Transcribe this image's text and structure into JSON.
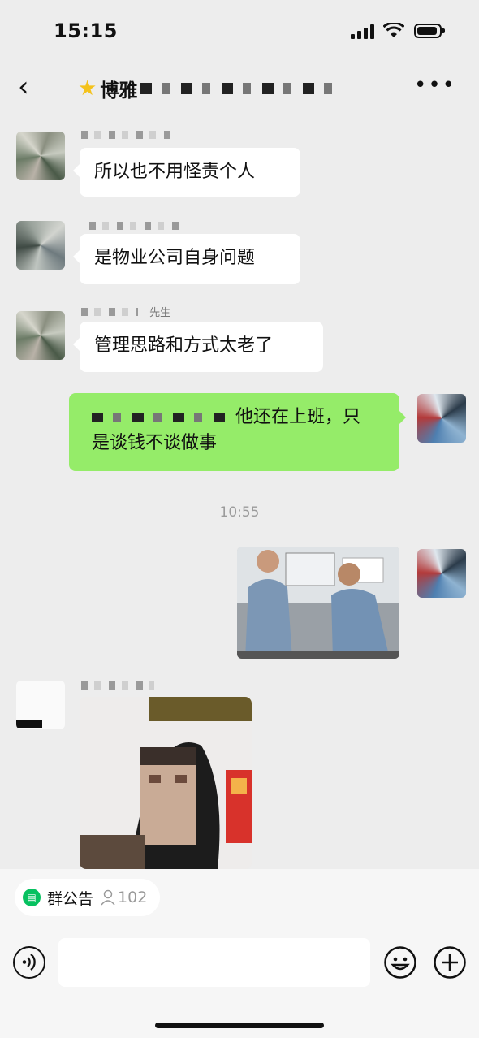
{
  "status_bar": {
    "time": "15:15"
  },
  "header": {
    "title_prefix": "博雅",
    "back_icon": "chevron-left-icon",
    "more_icon": "ellipsis-icon",
    "star_icon": "star-icon"
  },
  "messages": [
    {
      "type": "text",
      "side": "left",
      "text": "所以也不用怪责个人"
    },
    {
      "type": "text",
      "side": "left",
      "text": "是物业公司自身问题"
    },
    {
      "type": "text",
      "side": "left",
      "sender_suffix": "先生",
      "text": "管理思路和方式太老了"
    },
    {
      "type": "text",
      "side": "right",
      "line1": "他还在上班，只",
      "line2": "是谈钱不谈做事"
    },
    {
      "type": "timestamp",
      "text": "10:55"
    },
    {
      "type": "image",
      "side": "right",
      "icon": "photo-icon"
    },
    {
      "type": "image",
      "side": "left",
      "icon": "photo-icon"
    }
  ],
  "notice_bar": {
    "label": "群公告",
    "member_count": "102"
  },
  "input_bar": {
    "voice_icon": "voice-icon",
    "emoji_icon": "emoji-icon",
    "plus_icon": "plus-icon",
    "placeholder": ""
  },
  "colors": {
    "background": "#ededed",
    "self_bubble": "#95ec69",
    "other_bubble": "#ffffff",
    "accent": "#07c160"
  }
}
